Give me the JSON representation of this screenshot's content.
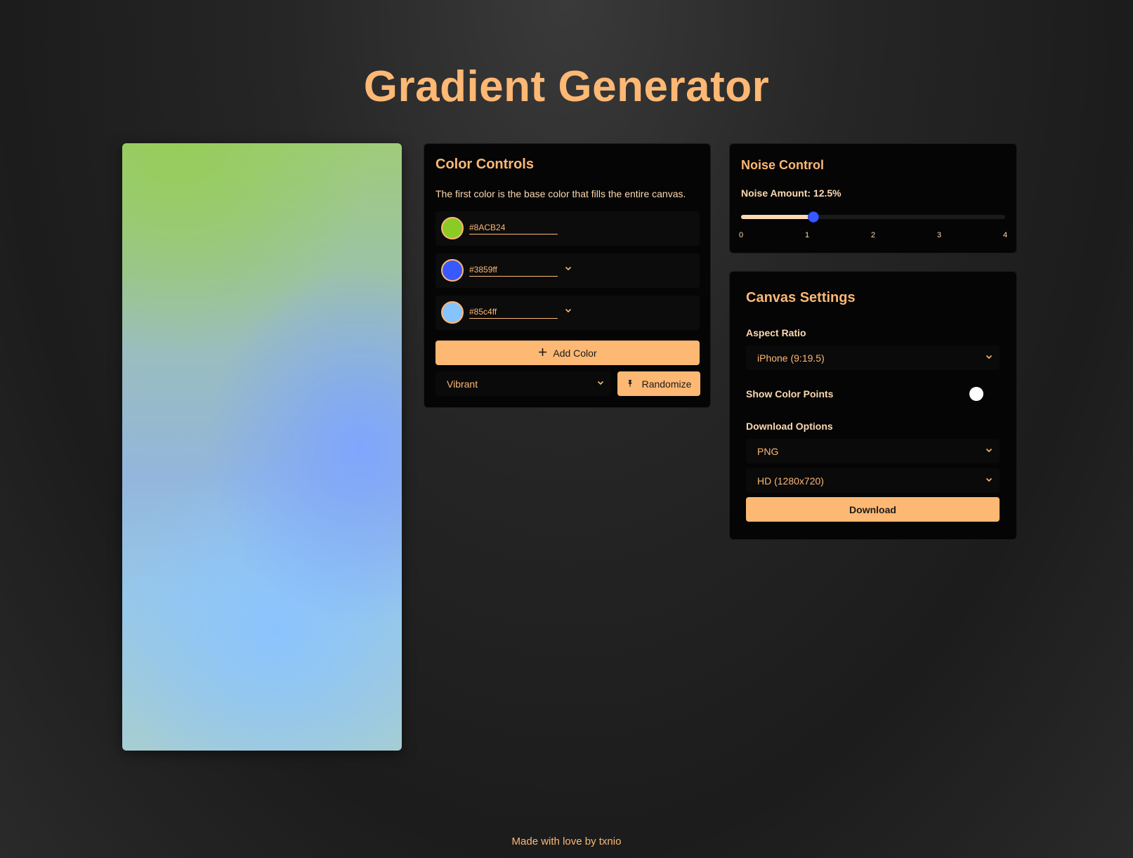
{
  "page": {
    "title": "Gradient Generator",
    "footer": "Made with love by txnio"
  },
  "color_controls": {
    "title": "Color Controls",
    "description": "The first color is the base color that fills the entire canvas.",
    "colors": [
      {
        "hex": "#8ACB24",
        "swatch": "#8acb24"
      },
      {
        "hex": "#3859ff",
        "swatch": "#3859ff"
      },
      {
        "hex": "#85c4ff",
        "swatch": "#85c4ff"
      }
    ],
    "add_label": "Add Color",
    "palette_selected": "Vibrant",
    "randomize_label": "Randomize"
  },
  "noise_control": {
    "title": "Noise Control",
    "amount_label": "Noise Amount: 12.5%",
    "value": 1.1,
    "min": 0,
    "max": 4,
    "ticks": [
      "0",
      "1",
      "2",
      "3",
      "4"
    ]
  },
  "canvas_settings": {
    "title": "Canvas Settings",
    "aspect_label": "Aspect Ratio",
    "aspect_selected": "iPhone (9:19.5)",
    "show_points_label": "Show Color Points",
    "download_options_label": "Download Options",
    "format_selected": "PNG",
    "resolution_selected": "HD (1280x720)",
    "download_label": "Download"
  },
  "theme": {
    "accent": "#fdb874",
    "slider_thumb": "#3859ff",
    "panel_bg": "#050505"
  },
  "icons": {
    "dropdown": "chevron-down-icon",
    "add": "plus-icon",
    "randomize": "pin-icon"
  }
}
